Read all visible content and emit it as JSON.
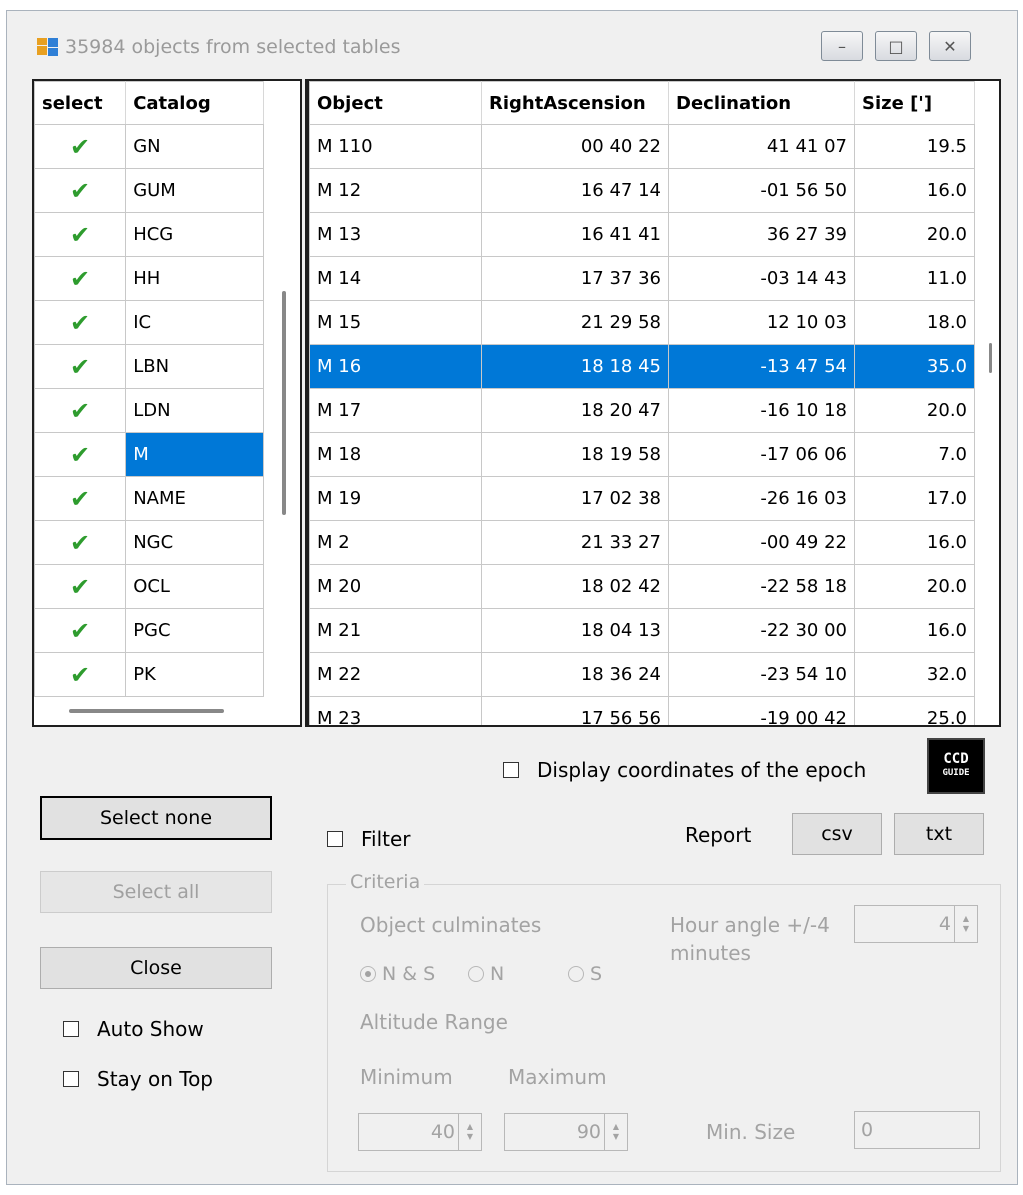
{
  "window": {
    "title": "35984 objects from selected tables",
    "controls": {
      "minimize": "–",
      "maximize": "□",
      "close": "✕"
    }
  },
  "catalog_table": {
    "headers": {
      "select": "select",
      "catalog": "Catalog"
    },
    "check_glyph": "✔",
    "rows": [
      "GN",
      "GUM",
      "HCG",
      "HH",
      "IC",
      "LBN",
      "LDN",
      "M",
      "NAME",
      "NGC",
      "OCL",
      "PGC",
      "PK"
    ],
    "selected_catalog": "M"
  },
  "objects_table": {
    "headers": [
      "Object",
      "RightAscension",
      "Declination",
      "Size [']"
    ],
    "rows": [
      [
        "M 110",
        "00 40 22",
        "41 41 07",
        "19.5"
      ],
      [
        "M 12",
        "16 47 14",
        "-01 56 50",
        "16.0"
      ],
      [
        "M 13",
        "16 41 41",
        "36 27 39",
        "20.0"
      ],
      [
        "M 14",
        "17 37 36",
        "-03 14 43",
        "11.0"
      ],
      [
        "M 15",
        "21 29 58",
        "12 10 03",
        "18.0"
      ],
      [
        "M 16",
        "18 18 45",
        "-13 47 54",
        "35.0"
      ],
      [
        "M 17",
        "18 20 47",
        "-16 10 18",
        "20.0"
      ],
      [
        "M 18",
        "18 19 58",
        "-17 06 06",
        "7.0"
      ],
      [
        "M 19",
        "17 02 38",
        "-26 16 03",
        "17.0"
      ],
      [
        "M 2",
        "21 33 27",
        "-00 49 22",
        "16.0"
      ],
      [
        "M 20",
        "18 02 42",
        "-22 58 18",
        "20.0"
      ],
      [
        "M 21",
        "18 04 13",
        "-22 30 00",
        "16.0"
      ],
      [
        "M 22",
        "18 36 24",
        "-23 54 10",
        "32.0"
      ],
      [
        "M 23",
        "17 56 56",
        "-19 00 42",
        "25.0"
      ]
    ],
    "selected_object": "M 16"
  },
  "epoch_checkbox": {
    "label": "Display coordinates of the epoch",
    "checked": false
  },
  "logo": {
    "line1": "CCD",
    "line2": "GUIDE"
  },
  "buttons": {
    "select_none": "Select none",
    "select_all": "Select all",
    "close": "Close",
    "csv": "csv",
    "txt": "txt"
  },
  "report_label": "Report",
  "filter_checkbox": {
    "label": "Filter",
    "checked": false
  },
  "auto_show": {
    "label": "Auto Show",
    "checked": false
  },
  "stay_on_top": {
    "label": "Stay on Top",
    "checked": false
  },
  "criteria": {
    "title": "Criteria",
    "culminates_label": "Object culminates",
    "radio_ns": "N & S",
    "radio_n": "N",
    "radio_s": "S",
    "selected_radio": "N & S",
    "hour_angle_label": "Hour angle +/-4",
    "hour_angle_label2": "minutes",
    "hour_angle_value": "4",
    "altitude_label": "Altitude Range",
    "minimum_label": "Minimum",
    "maximum_label": "Maximum",
    "minimum_value": "40",
    "maximum_value": "90",
    "min_size_label": "Min. Size",
    "min_size_value": "0"
  }
}
